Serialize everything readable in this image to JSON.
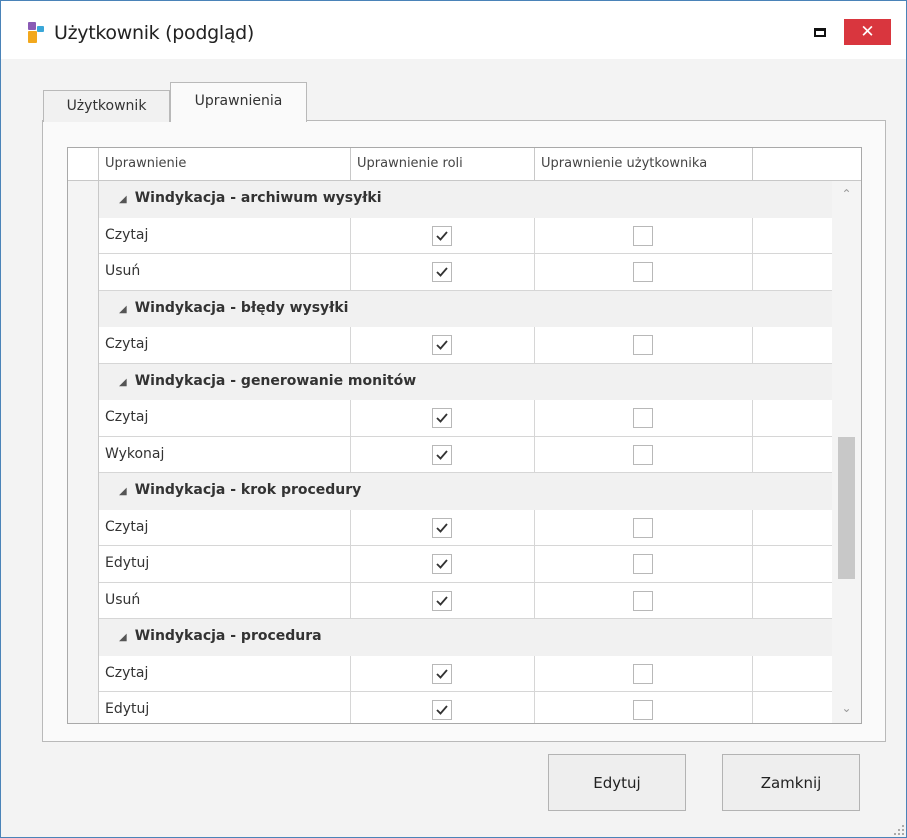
{
  "window": {
    "title": "Użytkownik (podgląd)",
    "close_glyph": "✕",
    "accent": "#4a83b8",
    "close_color": "#d9363e"
  },
  "tabs": [
    {
      "label": "Użytkownik",
      "active": false
    },
    {
      "label": "Uprawnienia",
      "active": true
    }
  ],
  "grid": {
    "columns": [
      "",
      "Uprawnienie",
      "Uprawnienie roli",
      "Uprawnienie użytkownika",
      ""
    ],
    "rows": [
      {
        "type": "group",
        "label": "Windykacja - archiwum wysyłki"
      },
      {
        "type": "item",
        "name": "Czytaj",
        "role": true,
        "user": false
      },
      {
        "type": "item",
        "name": "Usuń",
        "role": true,
        "user": false
      },
      {
        "type": "group",
        "label": "Windykacja - błędy wysyłki"
      },
      {
        "type": "item",
        "name": "Czytaj",
        "role": true,
        "user": false
      },
      {
        "type": "group",
        "label": "Windykacja - generowanie monitów"
      },
      {
        "type": "item",
        "name": "Czytaj",
        "role": true,
        "user": false
      },
      {
        "type": "item",
        "name": "Wykonaj",
        "role": true,
        "user": false
      },
      {
        "type": "group",
        "label": "Windykacja - krok procedury"
      },
      {
        "type": "item",
        "name": "Czytaj",
        "role": true,
        "user": false
      },
      {
        "type": "item",
        "name": "Edytuj",
        "role": true,
        "user": false
      },
      {
        "type": "item",
        "name": "Usuń",
        "role": true,
        "user": false
      },
      {
        "type": "group",
        "label": "Windykacja - procedura"
      },
      {
        "type": "item",
        "name": "Czytaj",
        "role": true,
        "user": false
      },
      {
        "type": "item",
        "name": "Edytuj",
        "role": true,
        "user": false
      }
    ]
  },
  "icons": {
    "expand": "◢",
    "scroll_up": "⌃",
    "scroll_down": "⌄"
  },
  "buttons": {
    "edit": "Edytuj",
    "close": "Zamknij"
  }
}
